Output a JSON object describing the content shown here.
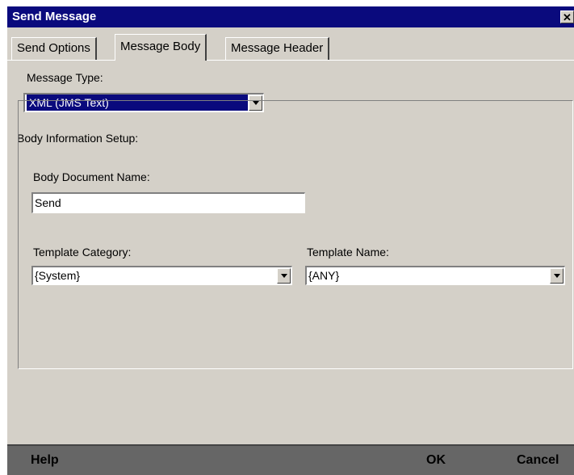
{
  "window": {
    "title": "Send Message",
    "close_glyph": "✕"
  },
  "tabs": [
    {
      "label": "Send Options",
      "active": false
    },
    {
      "label": "Message Body",
      "active": true
    },
    {
      "label": "Message Header",
      "active": false
    }
  ],
  "message_type": {
    "label": "Message Type:",
    "value": "XML (JMS Text)"
  },
  "body_setup": {
    "label": "Body Information Setup:",
    "doc_name_label": "Body Document Name:",
    "doc_name_value": "Send",
    "template_category_label": "Template Category:",
    "template_category_value": "{System}",
    "template_name_label": "Template Name:",
    "template_name_value": "{ANY}"
  },
  "buttons": {
    "help": "Help",
    "ok": "OK",
    "cancel": "Cancel"
  },
  "colors": {
    "titlebar": "#0a0a7d",
    "face": "#d4d0c8",
    "bottombar": "#666666"
  }
}
